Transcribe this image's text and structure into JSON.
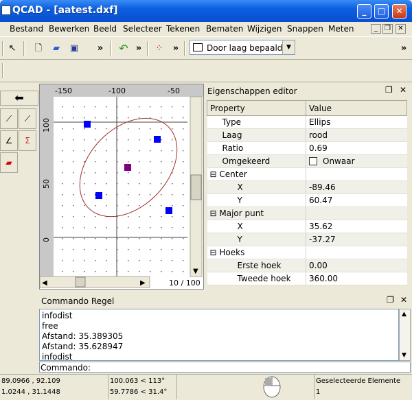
{
  "window": {
    "title": "QCAD - [aatest.dxf]"
  },
  "menu": [
    "Bestand",
    "Bewerken",
    "Beeld",
    "Selecteer",
    "Tekenen",
    "Bematen",
    "Wijzigen",
    "Snappen",
    "Meten"
  ],
  "toolbar": {
    "layer_combo": "Door laag bepaald",
    "more": "»"
  },
  "drawing": {
    "x_ticks": [
      "-150",
      "-100",
      "-50"
    ],
    "y_ticks": [
      "100",
      "50",
      "0"
    ],
    "zoom_label": "10 / 100"
  },
  "properties": {
    "title": "Eigenschappen editor",
    "col_property": "Property",
    "col_value": "Value",
    "rows": [
      {
        "label": "Type",
        "value": "Ellips",
        "indent": 1
      },
      {
        "label": "Laag",
        "value": "rood",
        "indent": 1
      },
      {
        "label": "Ratio",
        "value": "0.69",
        "indent": 1
      },
      {
        "label": "Omgekeerd",
        "value": "Onwaar",
        "indent": 1,
        "checkbox": true
      },
      {
        "label": "Center",
        "value": "",
        "indent": 0,
        "group": true
      },
      {
        "label": "X",
        "value": "-89.46",
        "indent": 2
      },
      {
        "label": "Y",
        "value": "60.47",
        "indent": 2
      },
      {
        "label": "Major punt",
        "value": "",
        "indent": 0,
        "group": true
      },
      {
        "label": "X",
        "value": "35.62",
        "indent": 2
      },
      {
        "label": "Y",
        "value": "-37.27",
        "indent": 2
      },
      {
        "label": "Hoeks",
        "value": "",
        "indent": 0,
        "group": true
      },
      {
        "label": "Erste hoek",
        "value": "0.00",
        "indent": 2
      },
      {
        "label": "Tweede hoek",
        "value": "360.00",
        "indent": 2
      }
    ]
  },
  "command": {
    "title": "Commando Regel",
    "log": [
      "infodist",
      "free",
      "Afstand: 35.389305",
      "Afstand: 35.628947",
      "infodist"
    ],
    "prompt": "Commando:"
  },
  "status": {
    "abs1": "89.0966 , 92.109",
    "abs2": "1.0244 , 31.1448",
    "rel1": "100.063 < 113°",
    "rel2": "59.7786 < 31.4°",
    "sel_label": "Geselecteerde Elemente",
    "sel_count": "1"
  },
  "colors": {
    "titlebar": "#0b5fe0",
    "ellipse": "#a03030",
    "handle": "#0000ff"
  }
}
